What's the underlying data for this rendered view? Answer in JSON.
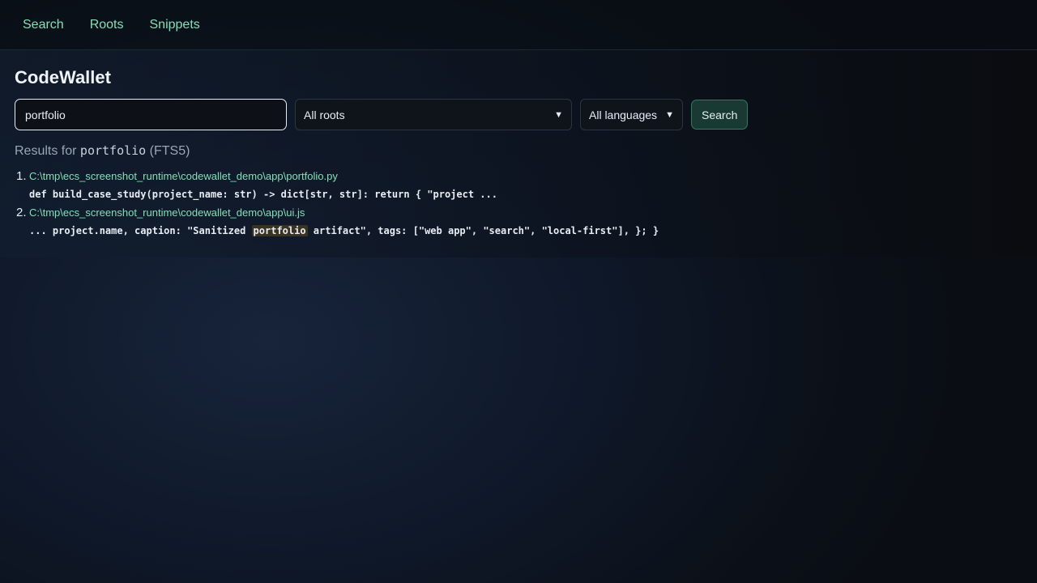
{
  "nav": {
    "items": [
      "Search",
      "Roots",
      "Snippets"
    ]
  },
  "app_title": "CodeWallet",
  "search": {
    "query": "portfolio",
    "roots_selected": "All roots",
    "languages_selected": "All languages",
    "button_label": "Search"
  },
  "results_header": {
    "prefix": "Results for",
    "term": "portfolio",
    "suffix": "(FTS5)"
  },
  "results": [
    {
      "number": "1.",
      "path": "C:\\tmp\\ecs_screenshot_runtime\\codewallet_demo\\app\\portfolio.py",
      "snippet": "def build_case_study(project_name: str) -> dict[str, str]: return { \"project ..."
    },
    {
      "number": "2.",
      "path": "C:\\tmp\\ecs_screenshot_runtime\\codewallet_demo\\app\\ui.js",
      "snippet_before": "... project.name, caption: \"Sanitized ",
      "snippet_highlight": "portfolio",
      "snippet_after": " artifact\", tags: [\"web app\", \"search\", \"local-first\"], }; }"
    }
  ]
}
